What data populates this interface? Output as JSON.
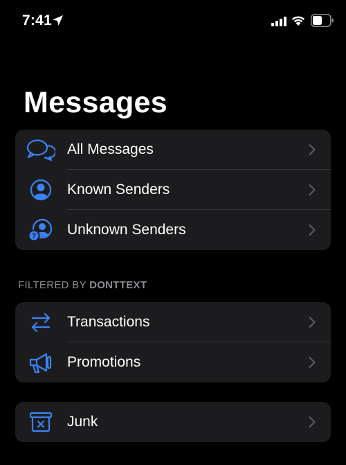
{
  "status_bar": {
    "time": "7:41"
  },
  "page_title": "Messages",
  "groups": {
    "main": [
      {
        "label": "All Messages",
        "icon": "chat-bubbles-icon"
      },
      {
        "label": "Known Senders",
        "icon": "person-circle-icon"
      },
      {
        "label": "Unknown Senders",
        "icon": "person-question-icon"
      }
    ],
    "filtered": [
      {
        "label": "Transactions",
        "icon": "arrows-exchange-icon"
      },
      {
        "label": "Promotions",
        "icon": "megaphone-icon"
      }
    ],
    "junk": [
      {
        "label": "Junk",
        "icon": "xmark-bin-icon"
      }
    ]
  },
  "section_header": {
    "prefix": "FILTERED BY ",
    "brand": "DONTTEXT"
  },
  "colors": {
    "accent": "#3b82f6",
    "background": "#000000",
    "group_bg": "#1c1c1e",
    "chevron": "#5a5a5e",
    "secondary_text": "#8d8d93"
  }
}
